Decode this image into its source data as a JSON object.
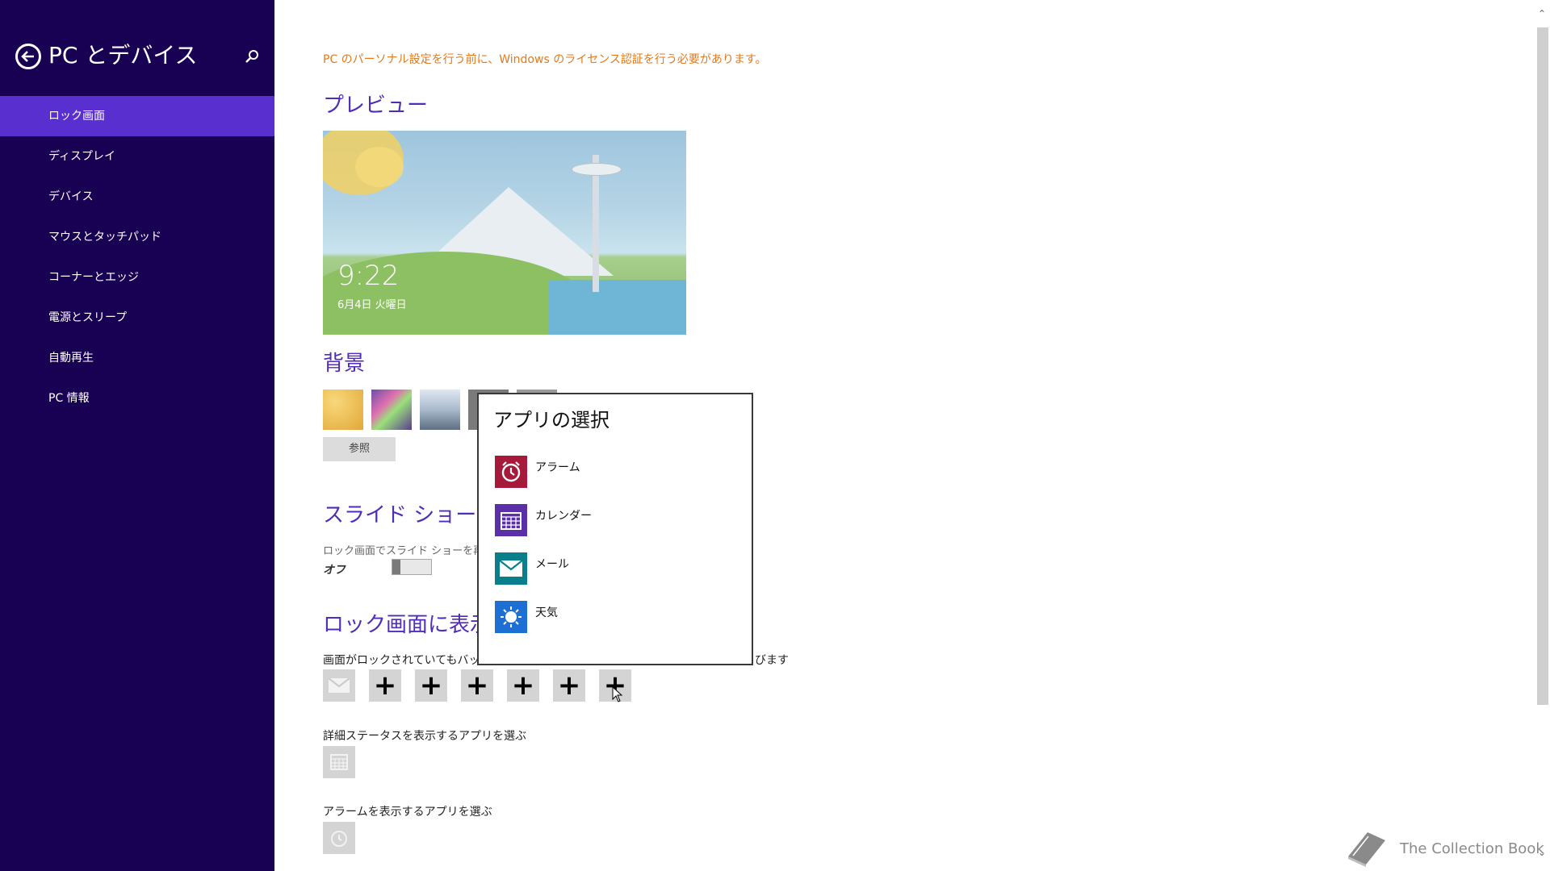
{
  "sidebar": {
    "title": "PC とデバイス",
    "items": [
      {
        "label": "ロック画面",
        "selected": true
      },
      {
        "label": "ディスプレイ"
      },
      {
        "label": "デバイス"
      },
      {
        "label": "マウスとタッチパッド"
      },
      {
        "label": "コーナーとエッジ"
      },
      {
        "label": "電源とスリープ"
      },
      {
        "label": "自動再生"
      },
      {
        "label": "PC 情報"
      }
    ]
  },
  "main": {
    "notice": "PC のパーソナル設定を行う前に、Windows のライセンス認証を行う必要があります。",
    "preview": {
      "heading": "プレビュー",
      "time": "9:22",
      "date": "6月4日 火曜日"
    },
    "background": {
      "heading": "背景",
      "browse_label": "参照"
    },
    "slideshow": {
      "heading": "スライド ショー",
      "description": "ロック画面でスライド ショーを再生",
      "toggle_state": "オフ"
    },
    "lock_apps": {
      "heading": "ロック画面に表示す",
      "description_left": "画面がロックされていてもバックグラ",
      "description_right": "びます",
      "detailed_label": "詳細ステータスを表示するアプリを選ぶ",
      "alarm_label": "アラームを表示するアプリを選ぶ"
    }
  },
  "popup": {
    "title": "アプリの選択",
    "items": [
      {
        "label": "アラーム",
        "icon": "alarm-icon",
        "color": "#a6193a"
      },
      {
        "label": "カレンダー",
        "icon": "calendar-icon",
        "color": "#5b2fa8"
      },
      {
        "label": "メール",
        "icon": "mail-icon",
        "color": "#0a7f8c"
      },
      {
        "label": "天気",
        "icon": "weather-icon",
        "color": "#1d6fd4"
      }
    ]
  },
  "watermark": "The Collection Book",
  "colors": {
    "sidebar_bg": "#180052",
    "selected": "#5a2fd0",
    "heading": "#4f2db8",
    "notice": "#e07a1f"
  }
}
